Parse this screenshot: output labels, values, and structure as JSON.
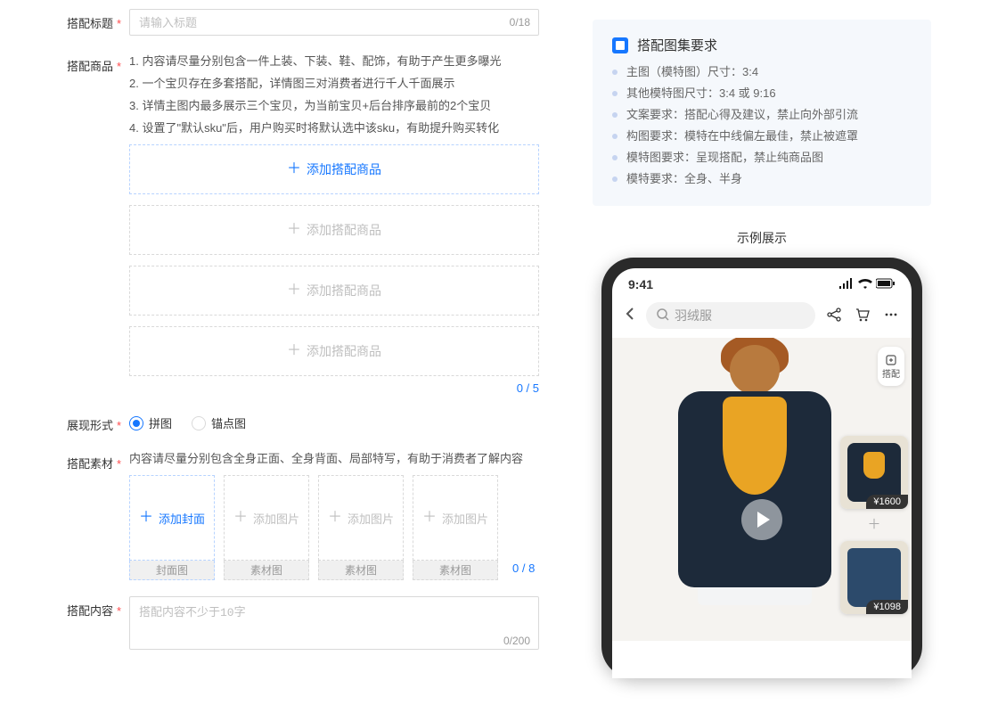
{
  "fields": {
    "title": {
      "label": "搭配标题",
      "placeholder": "请输入标题",
      "counter": "0/18"
    },
    "goods": {
      "label": "搭配商品",
      "tips": [
        "1. 内容请尽量分别包含一件上装、下装、鞋、配饰，有助于产生更多曝光",
        "2. 一个宝贝存在多套搭配，详情图三对消费者进行千人千面展示",
        "3. 详情主图内最多展示三个宝贝，为当前宝贝+后台排序最前的2个宝贝",
        "4. 设置了\"默认sku\"后，用户购买时将默认选中该sku，有助提升购买转化"
      ],
      "add_primary": "添加搭配商品",
      "add_more": [
        "添加搭配商品",
        "添加搭配商品",
        "添加搭配商品"
      ],
      "count": "0 / 5"
    },
    "display": {
      "label": "展现形式",
      "options": [
        {
          "label": "拼图",
          "checked": true
        },
        {
          "label": "锚点图",
          "checked": false
        }
      ]
    },
    "material": {
      "label": "搭配素材",
      "tip": "内容请尽量分别包含全身正面、全身背面、局部特写，有助于消费者了解内容",
      "boxes": [
        {
          "upload": "添加封面",
          "caption": "封面图",
          "primary": true
        },
        {
          "upload": "添加图片",
          "caption": "素材图",
          "primary": false
        },
        {
          "upload": "添加图片",
          "caption": "素材图",
          "primary": false
        },
        {
          "upload": "添加图片",
          "caption": "素材图",
          "primary": false
        }
      ],
      "count": "0 / 8"
    },
    "content": {
      "label": "搭配内容",
      "placeholder": "搭配内容不少于10字",
      "counter": "0/200"
    }
  },
  "requirements": {
    "title": "搭配图集要求",
    "items": [
      "主图（模特图）尺寸：3:4",
      "其他模特图尺寸：3:4 或 9:16",
      "文案要求：搭配心得及建议，禁止向外部引流",
      "构图要求：模特在中线偏左最佳，禁止被遮罩",
      "模特图要求：呈现搭配，禁止纯商品图",
      "模特要求：全身、半身"
    ]
  },
  "preview": {
    "title": "示例展示",
    "status_time": "9:41",
    "search_placeholder": "羽绒服",
    "badge": "搭配",
    "products": [
      {
        "price": "¥1600",
        "kind": "jacket"
      },
      {
        "price": "¥1098",
        "kind": "jeans"
      }
    ]
  }
}
